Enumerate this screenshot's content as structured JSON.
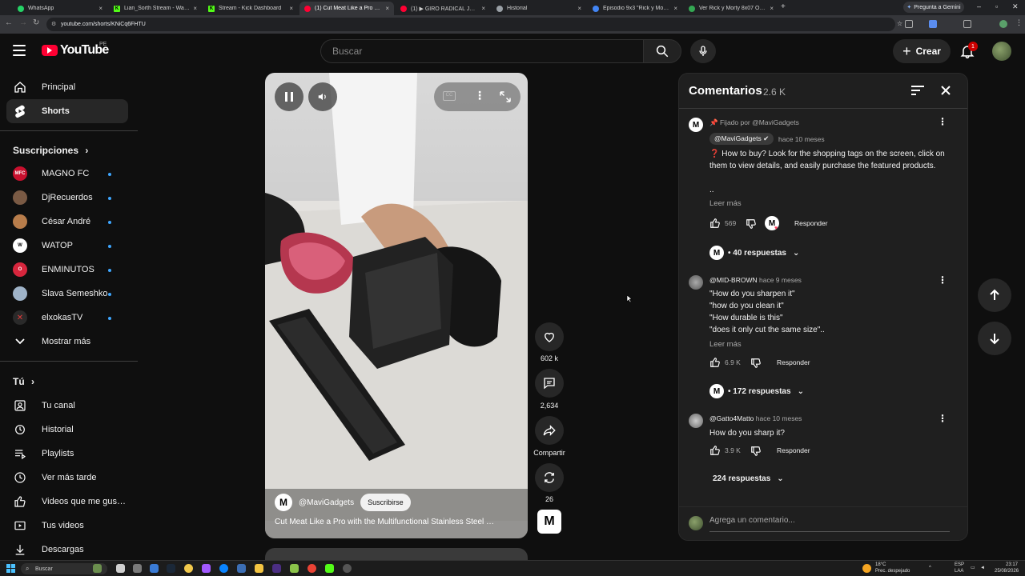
{
  "browser": {
    "tabs": [
      {
        "label": "WhatsApp",
        "color": "#25d366"
      },
      {
        "label": "Lian_Sorth Stream - Watch Live",
        "color": "#53fc18"
      },
      {
        "label": "Stream - Kick Dashboard",
        "color": "#53fc18"
      },
      {
        "label": "(1) Cut Meat Like a Pro with",
        "color": "#ff0033"
      },
      {
        "label": "(1) ▶ GIRO RADICAL JULI…",
        "color": "#ff0033"
      },
      {
        "label": "Historial",
        "color": "#9aa0a6"
      },
      {
        "label": "Episodio 9x3 \"Rick y Morty\"",
        "color": "#4285f4"
      },
      {
        "label": "Ver Rick y Morty 8x07 Online H",
        "color": "#34a853"
      }
    ],
    "gemini_label": "Pregunta a Gemini",
    "url": "youtube.com/shorts/KNiCq6FHTU"
  },
  "masthead": {
    "logo_text": "YouTube",
    "country": "PE",
    "search_placeholder": "Buscar",
    "create_label": "Crear",
    "notif_count": "1"
  },
  "sidebar": {
    "main": [
      {
        "label": "Principal",
        "icon": "home-icon"
      },
      {
        "label": "Shorts",
        "icon": "shorts-icon"
      }
    ],
    "subs_title": "Suscripciones",
    "subscriptions": [
      {
        "label": "MAGNO FC",
        "color": "#c8102e"
      },
      {
        "label": "DjRecuerdos",
        "color": "#7a5a44"
      },
      {
        "label": "César André",
        "color": "#b87d4b"
      },
      {
        "label": "WATOP",
        "color": "#ffffff"
      },
      {
        "label": "ENMINUTOS",
        "color": "#d7263d"
      },
      {
        "label": "Slava Semeshko",
        "color": "#9fb3c8"
      },
      {
        "label": "elxokasTV",
        "color": "#e23b3b"
      }
    ],
    "show_more": "Mostrar más",
    "you_title": "Tú",
    "you_items": [
      {
        "label": "Tu canal",
        "icon": "channel-icon"
      },
      {
        "label": "Historial",
        "icon": "history-icon"
      },
      {
        "label": "Playlists",
        "icon": "playlists-icon"
      },
      {
        "label": "Ver más tarde",
        "icon": "watch-later-icon"
      },
      {
        "label": "Videos que me gus…",
        "icon": "liked-videos-icon"
      },
      {
        "label": "Tus videos",
        "icon": "your-videos-icon"
      },
      {
        "label": "Descargas",
        "icon": "downloads-icon"
      }
    ]
  },
  "video": {
    "channel": "@MaviGadgets",
    "channel_initial": "M",
    "subscribe_label": "Suscribirse",
    "title": "Cut Meat Like a Pro with the Multifunctional Stainless Steel …"
  },
  "actions": {
    "likes": "602 k",
    "comments": "2,634",
    "share": "Compartir",
    "remix": "26"
  },
  "comments": {
    "title": "Comentarios",
    "count": "2.6 K",
    "pinned": {
      "pinned_by": "Fijado por @MaviGadgets",
      "author": "@MaviGadgets",
      "time": "hace 10 meses",
      "text": "❓ How to buy? Look for the shopping tags on the screen, click on them to view details, and easily purchase the featured products.",
      "ellipsis": "..",
      "read_more": "Leer más",
      "likes": "569",
      "reply": "Responder",
      "replies": "• 40 respuestas"
    },
    "c2": {
      "author": "@MID-BROWN",
      "time": "hace 9 meses",
      "lines": [
        "\"How do you sharpen it\"",
        "\"how do you clean it\"",
        "\"How durable is this\"",
        "\"does it only cut the same size\".."
      ],
      "read_more": "Leer más",
      "likes": "6.9 K",
      "reply": "Responder",
      "replies": "• 172 respuestas"
    },
    "c3": {
      "author": "@Gatto4Matto",
      "time": "hace 10 meses",
      "text": "How do you sharp it?",
      "likes": "3.9 K",
      "reply": "Responder",
      "replies": "224 respuestas"
    },
    "add_placeholder": "Agrega un comentario..."
  },
  "taskbar": {
    "search": "Buscar",
    "weather_temp": "18°C",
    "weather_desc": "Prec. despejado",
    "lang1": "ESP",
    "lang2": "LAA",
    "time": "23:17",
    "date": "25/08/2026"
  }
}
